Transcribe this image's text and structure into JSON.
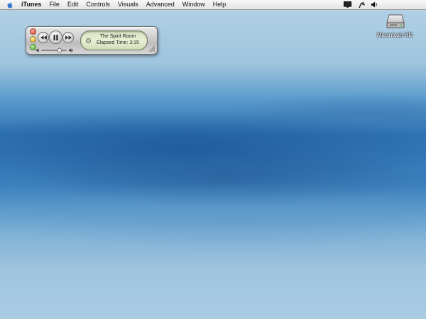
{
  "menubar": {
    "app_name": "iTunes",
    "menus": [
      "File",
      "Edit",
      "Controls",
      "Visuals",
      "Advanced",
      "Window",
      "Help"
    ],
    "right_icons": [
      "display-icon",
      "airport-signal-icon",
      "volume-icon"
    ]
  },
  "desktop": {
    "drive_label": "Macintosh HD"
  },
  "player": {
    "track_title": "The Spirit Room",
    "elapsed": "Elapsed Time: 3:15",
    "volume_level": 0.72,
    "state": "playing"
  },
  "colors": {
    "desktop_blue": "#2e73b3",
    "lcd_green": "#e9efd6",
    "close_red": "#d8321c",
    "minimize_yellow": "#e0a413",
    "zoom_green": "#3ea31a"
  }
}
